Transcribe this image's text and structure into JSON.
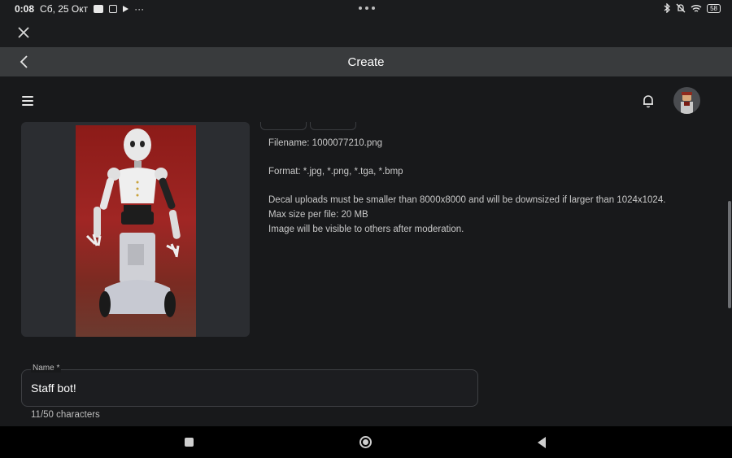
{
  "status_bar": {
    "time": "0:08",
    "date": "Сб, 25 Окт",
    "battery": "58"
  },
  "header": {
    "title": "Create"
  },
  "upload": {
    "filename": "Filename: 1000077210.png",
    "format": "Format: *.jpg, *.png, *.tga, *.bmp",
    "size_limit": "Decal uploads must be smaller than 8000x8000 and will be downsized if larger than 1024x1024.",
    "max_size": "Max size per file: 20 MB",
    "moderation": "Image will be visible to others after moderation."
  },
  "name_field": {
    "label": "Name *",
    "value": "Staff bot!",
    "char_count": "11/50 characters"
  },
  "icons": {
    "close": "close-icon",
    "back": "chevron-left-icon",
    "menu": "hamburger-menu-icon",
    "notifications": "bell-icon",
    "avatar": "user-avatar",
    "nav_recents": "square-icon",
    "nav_home": "circle-icon",
    "nav_back": "triangle-back-icon"
  },
  "colors": {
    "background": "#18191b",
    "header": "#393b3d",
    "card": "#2b2d31",
    "nav": "#000000"
  }
}
